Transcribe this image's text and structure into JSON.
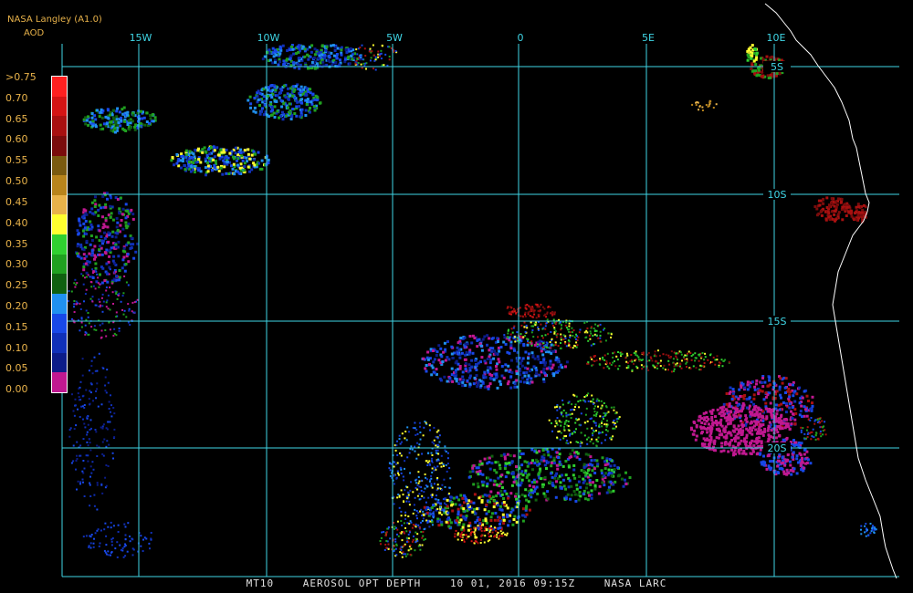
{
  "header": {
    "title": "NASA Langley (A1.0)",
    "product": "AOD"
  },
  "colorbar": {
    "labels": [
      ">0.75",
      "0.70",
      "0.65",
      "0.60",
      "0.55",
      "0.50",
      "0.45",
      "0.40",
      "0.35",
      "0.30",
      "0.25",
      "0.20",
      "0.15",
      "0.10",
      "0.05",
      "0.00"
    ],
    "colors": [
      "#ff2020",
      "#d41414",
      "#a81010",
      "#7a0c0c",
      "#7a5a10",
      "#b8841c",
      "#e8b24a",
      "#ffff30",
      "#30d030",
      "#20a020",
      "#106010",
      "#2090f0",
      "#1848e8",
      "#1030b8",
      "#0c1c88",
      "#c01890"
    ]
  },
  "map": {
    "lon_labels": [
      "15W",
      "10W",
      "5W",
      "0",
      "5E",
      "10E"
    ],
    "lat_labels": [
      "5S",
      "10S",
      "15S",
      "20S"
    ],
    "grid_color": "#3fd6e6",
    "coast_color": "#ffffff",
    "background": "#000000"
  },
  "footer": {
    "channel": "MT10",
    "product": "AEROSOL OPT DEPTH",
    "datetime": "10 01, 2016 09:15Z",
    "source": "NASA LARC"
  }
}
